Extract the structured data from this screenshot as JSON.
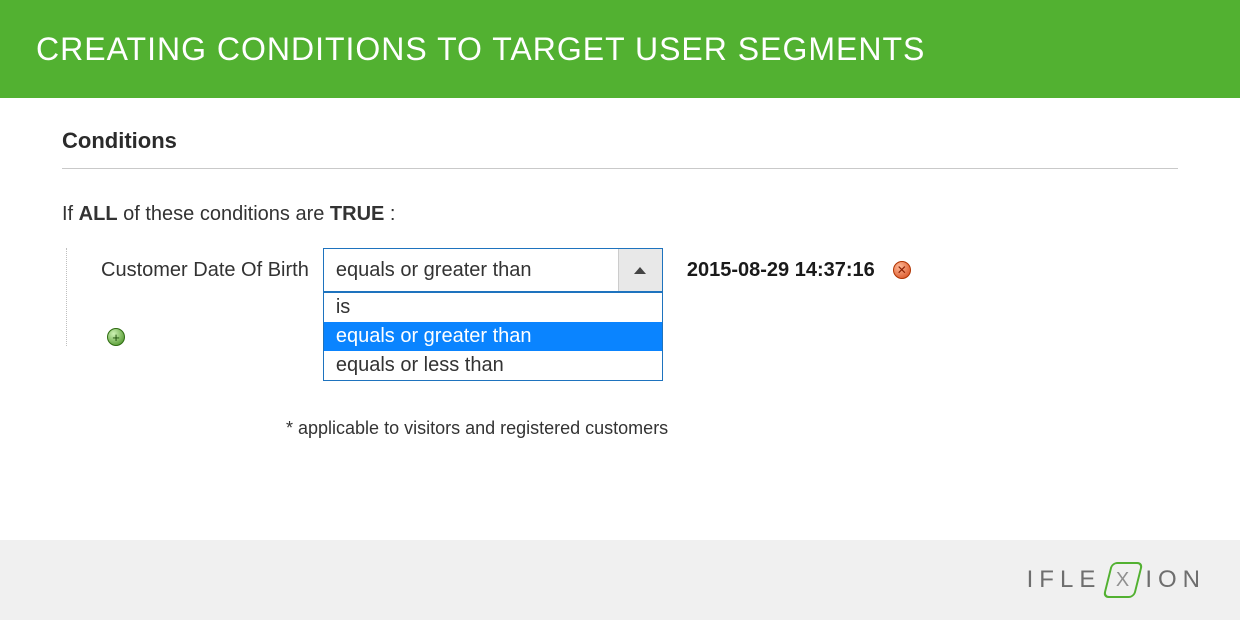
{
  "header": {
    "title": "CREATING CONDITIONS TO TARGET USER SEGMENTS"
  },
  "section": {
    "title": "Conditions"
  },
  "intro": {
    "prefix": "If ",
    "qualifier": "ALL",
    "middle": "  of these conditions are ",
    "state": "TRUE",
    "suffix": " :"
  },
  "condition": {
    "attribute": "Customer Date Of Birth",
    "operator_display": "equals or greater than",
    "options": [
      "is",
      "equals or greater than",
      "equals or less than"
    ],
    "selected_index": 1,
    "value": "2015-08-29 14:37:16"
  },
  "footnote": "* applicable to visitors and registered customers",
  "logo": {
    "part1": "IFLE",
    "mid": "X",
    "part2": "ION"
  }
}
